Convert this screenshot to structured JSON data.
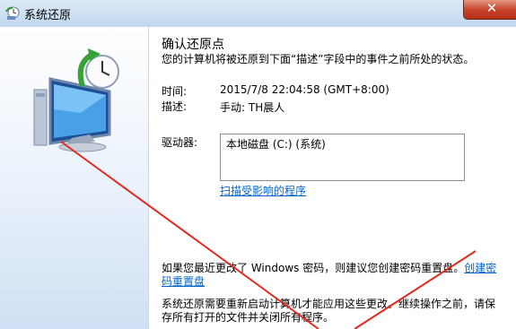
{
  "window": {
    "title": "系统还原",
    "close_glyph": "✕"
  },
  "left_panel": {
    "illustration_icon": "system-restore-icon"
  },
  "main": {
    "heading": "确认还原点",
    "description": "您的计算机将被还原到下面“描述”字段中的事件之前所处的状态。",
    "time_label": "时间:",
    "time_value": "2015/7/8 22:04:58 (GMT+8:00)",
    "desc_label": "描述:",
    "desc_value": "手动: TH晨人",
    "drives_label": "驱动器:",
    "drives": [
      "本地磁盘 (C:) (系统)"
    ],
    "scan_link": "扫描受影响的程序",
    "password_text": "如果您最近更改了 Windows 密码，则建议您创建密码重置盘。",
    "password_link": "创建密码重置盘",
    "restart_text": "系统还原需要重新启动计算机才能应用这些更改。继续操作之前，请保存所有打开的文件并关闭所有程序。"
  },
  "colors": {
    "link": "#0066cc",
    "annotation_line": "#e02a1e",
    "close_button": "#c7432b"
  }
}
